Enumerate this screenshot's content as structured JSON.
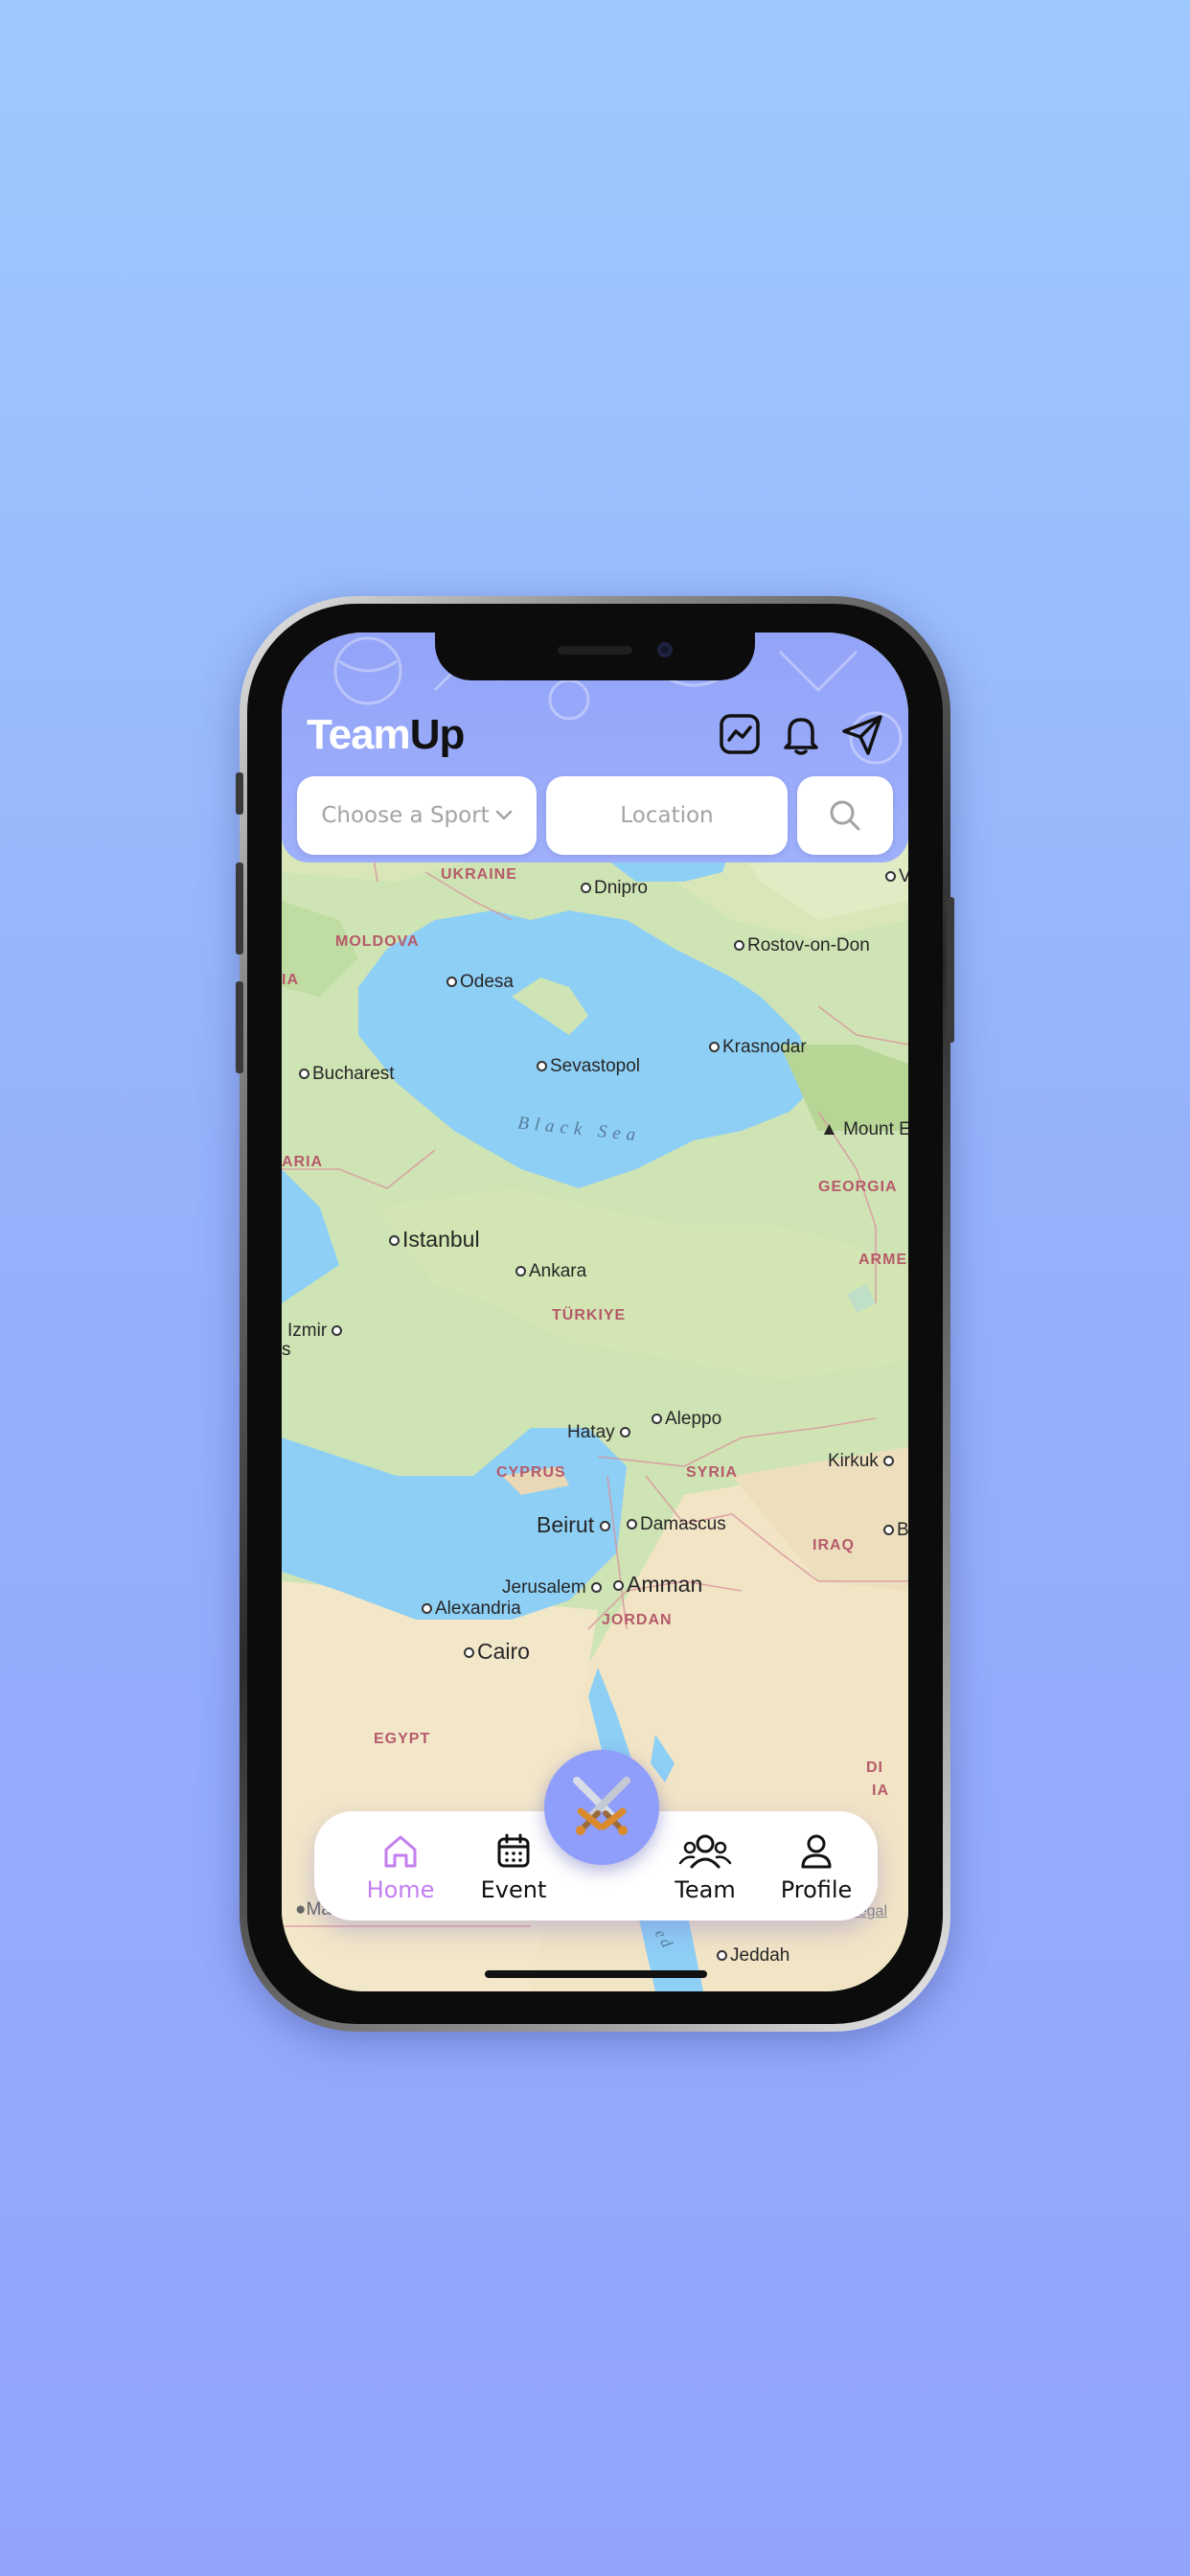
{
  "app": {
    "brand_part1": "Team",
    "brand_part2": "Up"
  },
  "header_icons": [
    "chart-icon",
    "bell-icon",
    "send-icon"
  ],
  "filters": {
    "sport_placeholder": "Choose a Sport",
    "location_placeholder": "Location"
  },
  "map": {
    "cities": {
      "dnipro": "Dnipro",
      "rostov": "Rostov-on-Don",
      "odesa": "Odesa",
      "krasnodar": "Krasnodar",
      "bucharest": "Bucharest",
      "sevastopol": "Sevastopol",
      "mount": "Mount Elb",
      "istanbul": "Istanbul",
      "ankara": "Ankara",
      "izmir": "Izmir",
      "aleppo": "Aleppo",
      "hatay": "Hatay",
      "kirkuk": "Kirkuk",
      "ba": "Ba",
      "beirut": "Beirut",
      "damascus": "Damascus",
      "jerusalem": "Jerusalem",
      "amman": "Amman",
      "alexandria": "Alexandria",
      "cairo": "Cairo",
      "jeddah": "Jeddah",
      "v": "V",
      "s": "s"
    },
    "countries": {
      "ukraine": "UKRAINE",
      "moldova": "MOLDOVA",
      "ia": "IA",
      "aria": "ARIA",
      "georgia": "GEORGIA",
      "armen": "ARMEN",
      "turkiye": "TÜRKIYE",
      "cyprus": "CYPRUS",
      "syria": "SYRIA",
      "iraq": "IRAQ",
      "jordan": "JORDAN",
      "egypt": "EGYPT",
      "di": "DI",
      "ia2": "IA"
    },
    "sea": "Black Sea",
    "red_sea": "ed",
    "attribution": "Ma",
    "legal": "Legal"
  },
  "nav": {
    "home": "Home",
    "event": "Event",
    "team": "Team",
    "profile": "Profile"
  },
  "fab_icon": "crossed-swords-icon",
  "colors": {
    "accent": "#8f9dfb",
    "active_nav": "#c37ef0",
    "header": "#93a3f8"
  }
}
